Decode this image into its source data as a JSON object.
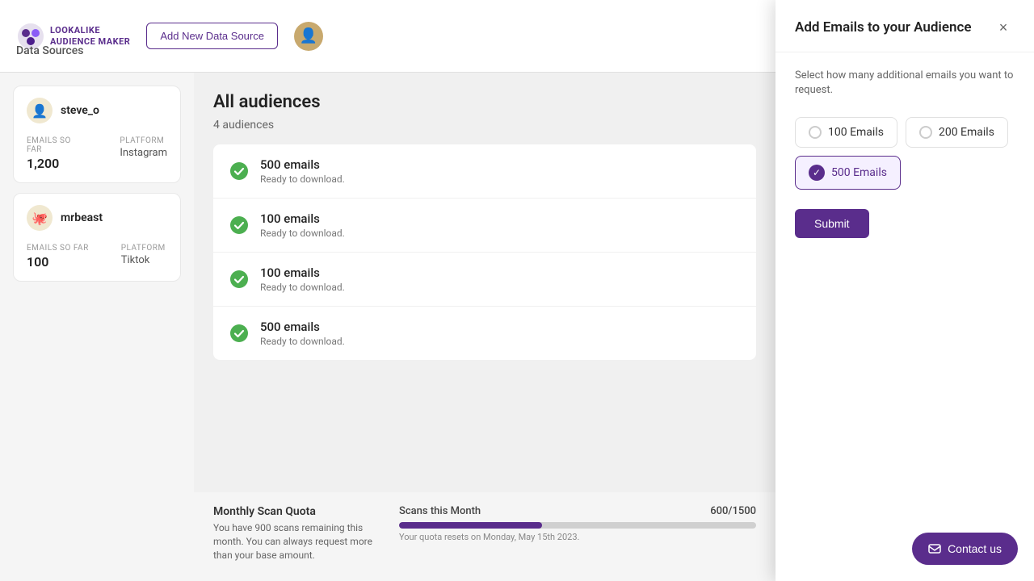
{
  "app": {
    "logo_text": "LOOKALIKE\nAUDIENCE MAKER"
  },
  "topbar": {
    "add_button_label": "Add New Data Source",
    "data_sources_label": "Data Sources"
  },
  "sidebar": {
    "sources": [
      {
        "name": "steve_o",
        "avatar": "👤",
        "emails_label": "EMAILS SO FAR",
        "emails_value": "1,200",
        "platform_label": "PLATFORM",
        "platform_value": "Instagram"
      },
      {
        "name": "mrbeast",
        "avatar": "🐙",
        "emails_label": "EMAILS SO FAR",
        "emails_value": "100",
        "platform_label": "PLATFORM",
        "platform_value": "Tiktok"
      }
    ]
  },
  "main": {
    "title": "All audiences",
    "count_label": "4 audiences",
    "audiences": [
      {
        "emails": "500 emails",
        "status": "Ready to download."
      },
      {
        "emails": "100 emails",
        "status": "Ready to download."
      },
      {
        "emails": "100 emails",
        "status": "Ready to download."
      },
      {
        "emails": "500 emails",
        "status": "Ready to download."
      }
    ]
  },
  "quota": {
    "title": "Monthly Scan Quota",
    "description": "You have 900 scans remaining this month. You can always request more than your base amount.",
    "scans_label": "Scans this Month",
    "scans_count": "600/1500",
    "progress_percent": 40,
    "reset_text": "Your quota resets on Monday, May 15th 2023."
  },
  "overlay": {
    "title": "Add Emails to your Audience",
    "close_label": "×",
    "subtitle": "Select how many additional emails you want to request.",
    "options": [
      {
        "label": "100 Emails",
        "value": "100",
        "selected": false
      },
      {
        "label": "200 Emails",
        "value": "200",
        "selected": false
      },
      {
        "label": "500 Emails",
        "value": "500",
        "selected": true
      }
    ],
    "submit_label": "Submit"
  },
  "contact": {
    "label": "Contact us"
  }
}
